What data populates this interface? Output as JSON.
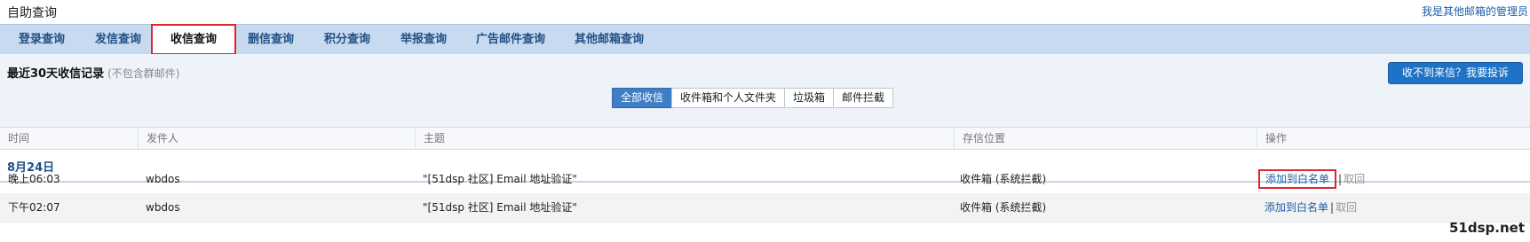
{
  "header": {
    "title": "自助查询",
    "admin_link": "我是其他邮箱的管理员"
  },
  "tabs": [
    {
      "label": "登录查询"
    },
    {
      "label": "发信查询"
    },
    {
      "label": "收信查询"
    },
    {
      "label": "删信查询"
    },
    {
      "label": "积分查询"
    },
    {
      "label": "举报查询"
    },
    {
      "label": "广告邮件查询"
    },
    {
      "label": "其他邮箱查询"
    }
  ],
  "active_tab": "收信查询",
  "records": {
    "title": "最近30天收信记录",
    "note": "(不包含群邮件)",
    "complain_button": "收不到来信？我要投诉"
  },
  "filters": [
    {
      "label": "全部收信",
      "active": true
    },
    {
      "label": "收件箱和个人文件夹",
      "active": false
    },
    {
      "label": "垃圾箱",
      "active": false
    },
    {
      "label": "邮件拦截",
      "active": false
    }
  ],
  "table": {
    "columns": [
      "时间",
      "发件人",
      "主题",
      "存信位置",
      "操作"
    ],
    "date_group": "8月24日",
    "rows": [
      {
        "time": "晚上06:03",
        "sender": "wbdos",
        "subject": "\"[51dsp 社区] Email 地址验证\"",
        "location": "收件箱 (系统拦截)",
        "action": "添加到白名单",
        "sep": "|",
        "revoke": "取回"
      },
      {
        "time": "下午02:07",
        "sender": "wbdos",
        "subject": "\"[51dsp 社区] Email 地址验证\"",
        "location": "收件箱 (系统拦截)",
        "action": "添加到白名单",
        "sep": "|",
        "revoke": "取回"
      }
    ]
  },
  "watermark": "51dsp.net",
  "colors": {
    "tab_bar": "#c8daf0",
    "highlight": "#e0262b",
    "accent": "#1f73c6"
  }
}
